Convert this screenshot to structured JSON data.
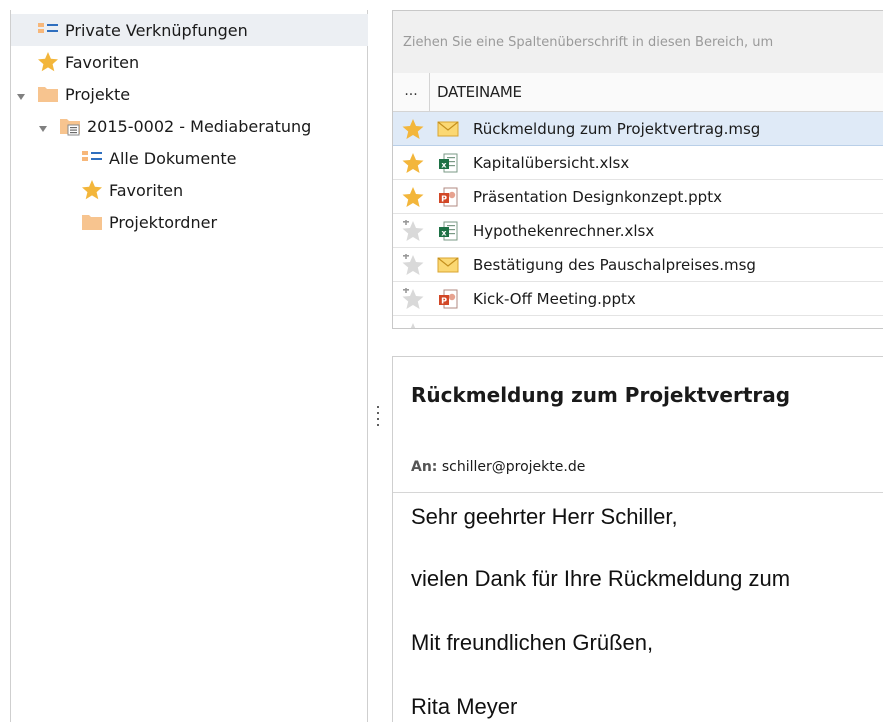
{
  "tree": {
    "items": [
      {
        "label": "Private Verknüpfungen",
        "icon": "shortcut-list-icon"
      },
      {
        "label": "Favoriten",
        "icon": "star-icon"
      },
      {
        "label": "Projekte",
        "icon": "folder-icon"
      },
      {
        "label": "2015-0002 - Mediaberatung",
        "icon": "project-folder-icon"
      },
      {
        "label": "Alle Dokumente",
        "icon": "shortcut-list-icon"
      },
      {
        "label": "Favoriten",
        "icon": "star-icon"
      },
      {
        "label": "Projektordner",
        "icon": "folder-icon"
      }
    ]
  },
  "grid": {
    "group_hint": "Ziehen Sie eine Spaltenüberschrift in diesen Bereich, um",
    "more_label": "...",
    "column_name": "DATEINAME",
    "rows": [
      {
        "name": "Rückmeldung zum Projektvertrag.msg",
        "type": "msg",
        "favorite": true
      },
      {
        "name": "Kapitalübersicht.xlsx",
        "type": "xlsx",
        "favorite": true
      },
      {
        "name": "Präsentation Designkonzept.pptx",
        "type": "pptx",
        "favorite": true
      },
      {
        "name": "Hypothekenrechner.xlsx",
        "type": "xlsx",
        "favorite": false
      },
      {
        "name": "Bestätigung des Pauschalpreises.msg",
        "type": "msg",
        "favorite": false
      },
      {
        "name": "Kick-Off Meeting.pptx",
        "type": "pptx",
        "favorite": false
      }
    ]
  },
  "preview": {
    "subject": "Rückmeldung zum Projektvertrag",
    "to_label": "An:",
    "to_value": "schiller@projekte.de",
    "body": [
      "Sehr geehrter Herr Schiller,",
      "vielen Dank für Ihre Rückmeldung zum",
      "Mit freundlichen Grüßen,",
      "Rita Meyer"
    ]
  },
  "colors": {
    "star": "#f3b63b",
    "folder": "#f7c48f",
    "selection": "#dfeaf7",
    "excel": "#1e7145",
    "powerpoint": "#d24726"
  }
}
